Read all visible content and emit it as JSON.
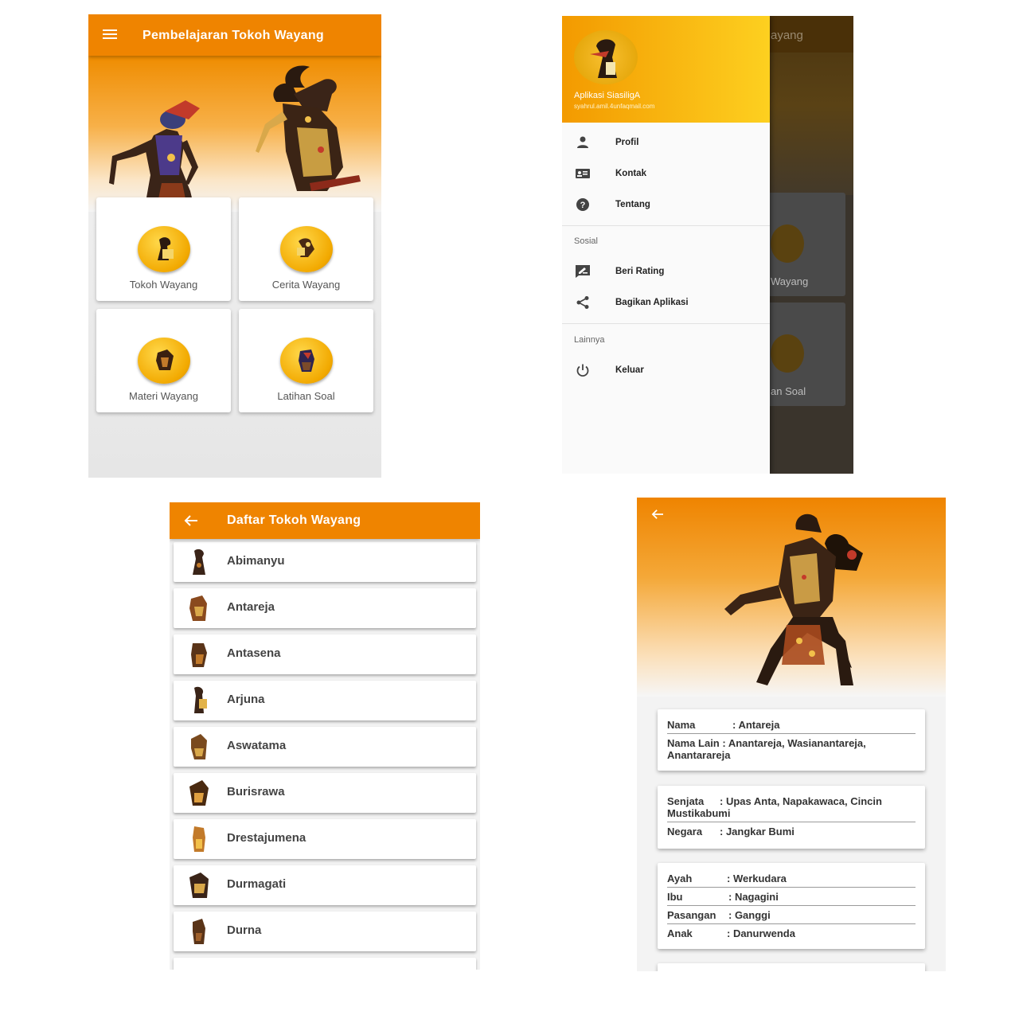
{
  "home": {
    "title": "Pembelajaran Tokoh Wayang",
    "icons": {
      "menu": "hamburger-menu-icon"
    },
    "menu_items": [
      {
        "label": "Tokoh Wayang",
        "icon": "wayang-puppet-icon"
      },
      {
        "label": "Cerita Wayang",
        "icon": "wayang-puppet-icon"
      },
      {
        "label": "Materi Wayang",
        "icon": "wayang-puppet-icon"
      },
      {
        "label": "Latihan Soal",
        "icon": "wayang-puppet-icon"
      }
    ]
  },
  "drawer": {
    "app_name": "Aplikasi SiasiligA",
    "email": "syahrul.amil.4unfaqmail.com",
    "items": [
      {
        "label": "Profil",
        "icon": "person-icon"
      },
      {
        "label": "Kontak",
        "icon": "contact-card-icon"
      },
      {
        "label": "Tentang",
        "icon": "help-circle-icon"
      }
    ],
    "section_social": "Sosial",
    "social_items": [
      {
        "label": "Beri Rating",
        "icon": "rate-review-icon"
      },
      {
        "label": "Bagikan Aplikasi",
        "icon": "share-icon"
      }
    ],
    "section_other": "Lainnya",
    "other_items": [
      {
        "label": "Keluar",
        "icon": "power-icon"
      }
    ],
    "background": {
      "appbar_partial": "ayang",
      "card1": "Wayang",
      "card2": "an Soal"
    }
  },
  "list": {
    "title": "Daftar Tokoh Wayang",
    "back_icon": "arrow-back-icon",
    "items": [
      "Abimanyu",
      "Antareja",
      "Antasena",
      "Arjuna",
      "Aswatama",
      "Burisrawa",
      "Drestajumena",
      "Durmagati",
      "Durna"
    ]
  },
  "detail": {
    "back_icon": "arrow-back-icon",
    "card1": [
      {
        "key": "Nama",
        "value": ": Antareja"
      },
      {
        "key": "Nama Lain",
        "value": ": Anantareja, Wasianantareja, Anantarareja"
      }
    ],
    "card2": [
      {
        "key": "Senjata",
        "value": ": Upas Anta, Napakawaca, Cincin Mustikabumi"
      },
      {
        "key": "Negara",
        "value": ": Jangkar Bumi"
      }
    ],
    "card3": [
      {
        "key": "Ayah",
        "value": ": Werkudara"
      },
      {
        "key": "Ibu",
        "value": ": Nagagini"
      },
      {
        "key": "Pasangan",
        "value": ": Ganggi"
      },
      {
        "key": "Anak",
        "value": ": Danurwenda"
      }
    ]
  },
  "colors": {
    "primary": "#ef8400",
    "accent": "#f2a900",
    "drawer_gradient_end": "#fdd020"
  }
}
